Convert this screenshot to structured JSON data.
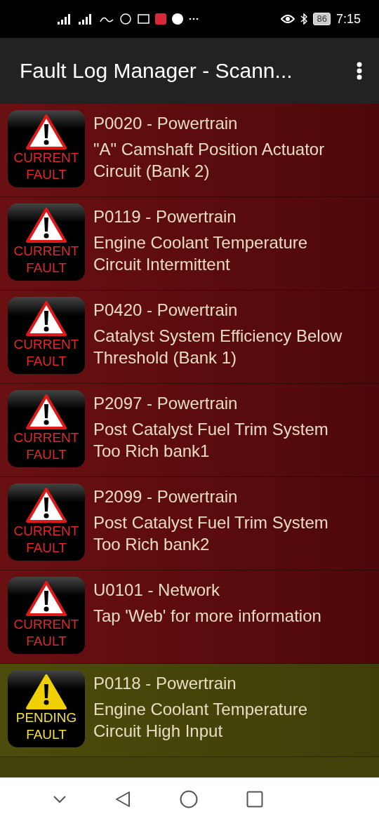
{
  "status_bar": {
    "battery": "86",
    "time": "7:15"
  },
  "app_bar": {
    "title": "Fault Log Manager - Scann..."
  },
  "faults": [
    {
      "kind": "current",
      "badge": [
        "CURRENT",
        "FAULT"
      ],
      "code": "P0020 - Powertrain",
      "description": "\"A\" Camshaft Position Actuator Circuit (Bank 2)"
    },
    {
      "kind": "current",
      "badge": [
        "CURRENT",
        "FAULT"
      ],
      "code": "P0119 - Powertrain",
      "description": "Engine Coolant Temperature Circuit Intermittent"
    },
    {
      "kind": "current",
      "badge": [
        "CURRENT",
        "FAULT"
      ],
      "code": "P0420 - Powertrain",
      "description": "Catalyst System Efficiency Below Threshold (Bank 1)"
    },
    {
      "kind": "current",
      "badge": [
        "CURRENT",
        "FAULT"
      ],
      "code": "P2097 - Powertrain",
      "description": "Post Catalyst Fuel Trim System Too Rich bank1"
    },
    {
      "kind": "current",
      "badge": [
        "CURRENT",
        "FAULT"
      ],
      "code": "P2099 - Powertrain",
      "description": "Post Catalyst Fuel Trim System Too Rich bank2"
    },
    {
      "kind": "current",
      "badge": [
        "CURRENT",
        "FAULT"
      ],
      "code": "U0101 - Network",
      "description": "Tap 'Web' for more information"
    },
    {
      "kind": "pending",
      "badge": [
        "PENDING",
        "FAULT"
      ],
      "code": "P0118 - Powertrain",
      "description": "Engine Coolant Temperature Circuit High Input"
    }
  ]
}
